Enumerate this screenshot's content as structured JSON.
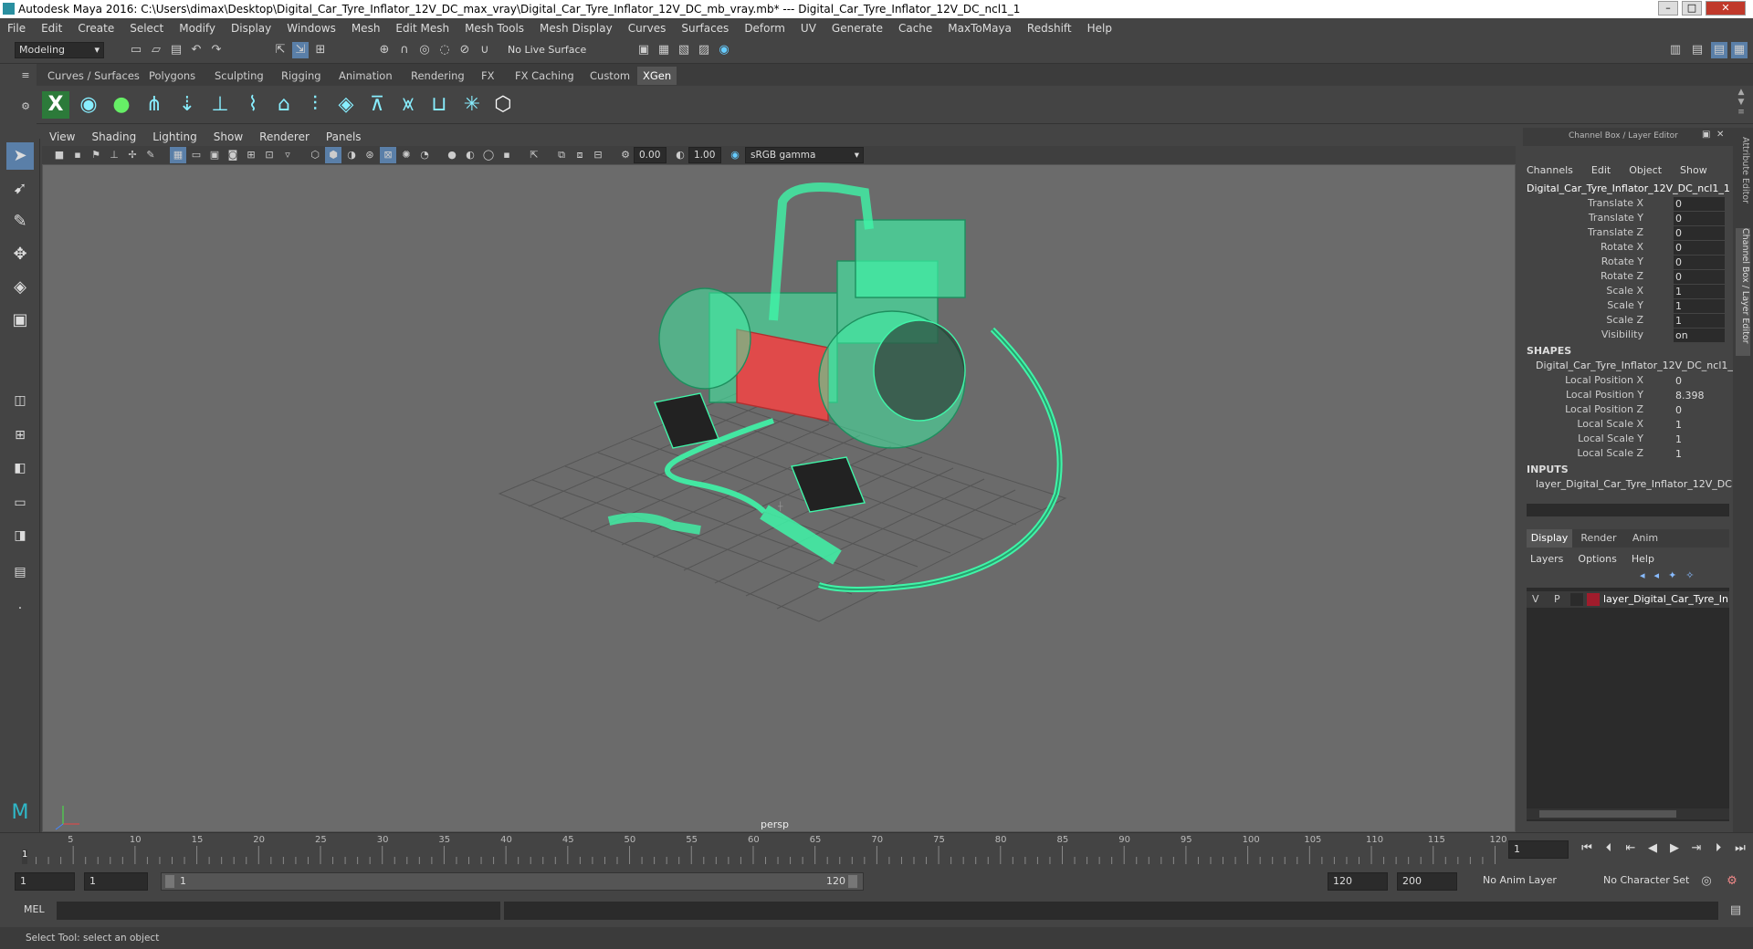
{
  "window": {
    "title": "Autodesk Maya 2016: C:\\Users\\dimax\\Desktop\\Digital_Car_Tyre_Inflator_12V_DC_max_vray\\Digital_Car_Tyre_Inflator_12V_DC_mb_vray.mb*   ---   Digital_Car_Tyre_Inflator_12V_DC_ncl1_1",
    "minimize": "–",
    "maximize": "□",
    "close": "✕"
  },
  "menubar": [
    "File",
    "Edit",
    "Create",
    "Select",
    "Modify",
    "Display",
    "Windows",
    "Mesh",
    "Edit Mesh",
    "Mesh Tools",
    "Mesh Display",
    "Curves",
    "Surfaces",
    "Deform",
    "UV",
    "Generate",
    "Cache",
    "MaxToMaya",
    "Redshift",
    "Help"
  ],
  "statusline": {
    "mode": "Modeling",
    "live_surface": "No Live Surface"
  },
  "shelf_tabs": [
    "Curves / Surfaces",
    "Polygons",
    "Sculpting",
    "Rigging",
    "Animation",
    "Rendering",
    "FX",
    "FX Caching",
    "Custom",
    "XGen"
  ],
  "shelf_active": "XGen",
  "viewport": {
    "menu": [
      "View",
      "Shading",
      "Lighting",
      "Show",
      "Renderer",
      "Panels"
    ],
    "exposure": "0.00",
    "gamma": "1.00",
    "color_space": "sRGB gamma",
    "camera_label": "persp",
    "wire_color": "#3ff5a8",
    "selection_color": "#e04a4a"
  },
  "channel_box": {
    "header": "Channel Box / Layer Editor",
    "menu": [
      "Channels",
      "Edit",
      "Object",
      "Show"
    ],
    "object_name": "Digital_Car_Tyre_Inflator_12V_DC_ncl1_1",
    "channels": [
      {
        "label": "Translate X",
        "value": "0"
      },
      {
        "label": "Translate Y",
        "value": "0"
      },
      {
        "label": "Translate Z",
        "value": "0"
      },
      {
        "label": "Rotate X",
        "value": "0"
      },
      {
        "label": "Rotate Y",
        "value": "0"
      },
      {
        "label": "Rotate Z",
        "value": "0"
      },
      {
        "label": "Scale X",
        "value": "1"
      },
      {
        "label": "Scale Y",
        "value": "1"
      },
      {
        "label": "Scale Z",
        "value": "1"
      },
      {
        "label": "Visibility",
        "value": "on"
      }
    ],
    "shapes_header": "SHAPES",
    "shape_name": "Digital_Car_Tyre_Inflator_12V_DC_ncl1_...",
    "shape_channels": [
      {
        "label": "Local Position X",
        "value": "0"
      },
      {
        "label": "Local Position Y",
        "value": "8.398"
      },
      {
        "label": "Local Position Z",
        "value": "0"
      },
      {
        "label": "Local Scale X",
        "value": "1"
      },
      {
        "label": "Local Scale Y",
        "value": "1"
      },
      {
        "label": "Local Scale Z",
        "value": "1"
      }
    ],
    "inputs_header": "INPUTS",
    "input_name": "layer_Digital_Car_Tyre_Inflator_12V_DC"
  },
  "layer_editor": {
    "tabs": [
      "Display",
      "Render",
      "Anim"
    ],
    "menu": [
      "Layers",
      "Options",
      "Help"
    ],
    "layer": {
      "v": "V",
      "p": "P",
      "name": "layer_Digital_Car_Tyre_In",
      "color": "#a01c2c"
    }
  },
  "side_tabs": [
    "Attribute Editor",
    "Channel Box / Layer Editor"
  ],
  "timeline": {
    "ticks": [
      "5",
      "10",
      "15",
      "20",
      "25",
      "30",
      "35",
      "40",
      "45",
      "50",
      "55",
      "60",
      "65",
      "70",
      "75",
      "80",
      "85",
      "90",
      "95",
      "100",
      "105",
      "110",
      "115",
      "120"
    ],
    "current_frame_marker": "1",
    "current_frame_field": "1"
  },
  "range": {
    "start": "1",
    "playback_start": "1",
    "slider_start": "1",
    "slider_end": "120",
    "playback_end": "120",
    "end": "200",
    "anim_layer": "No Anim Layer",
    "character_set": "No Character Set"
  },
  "cmdline": {
    "label": "MEL"
  },
  "helpline": {
    "text": "Select Tool: select an object"
  }
}
